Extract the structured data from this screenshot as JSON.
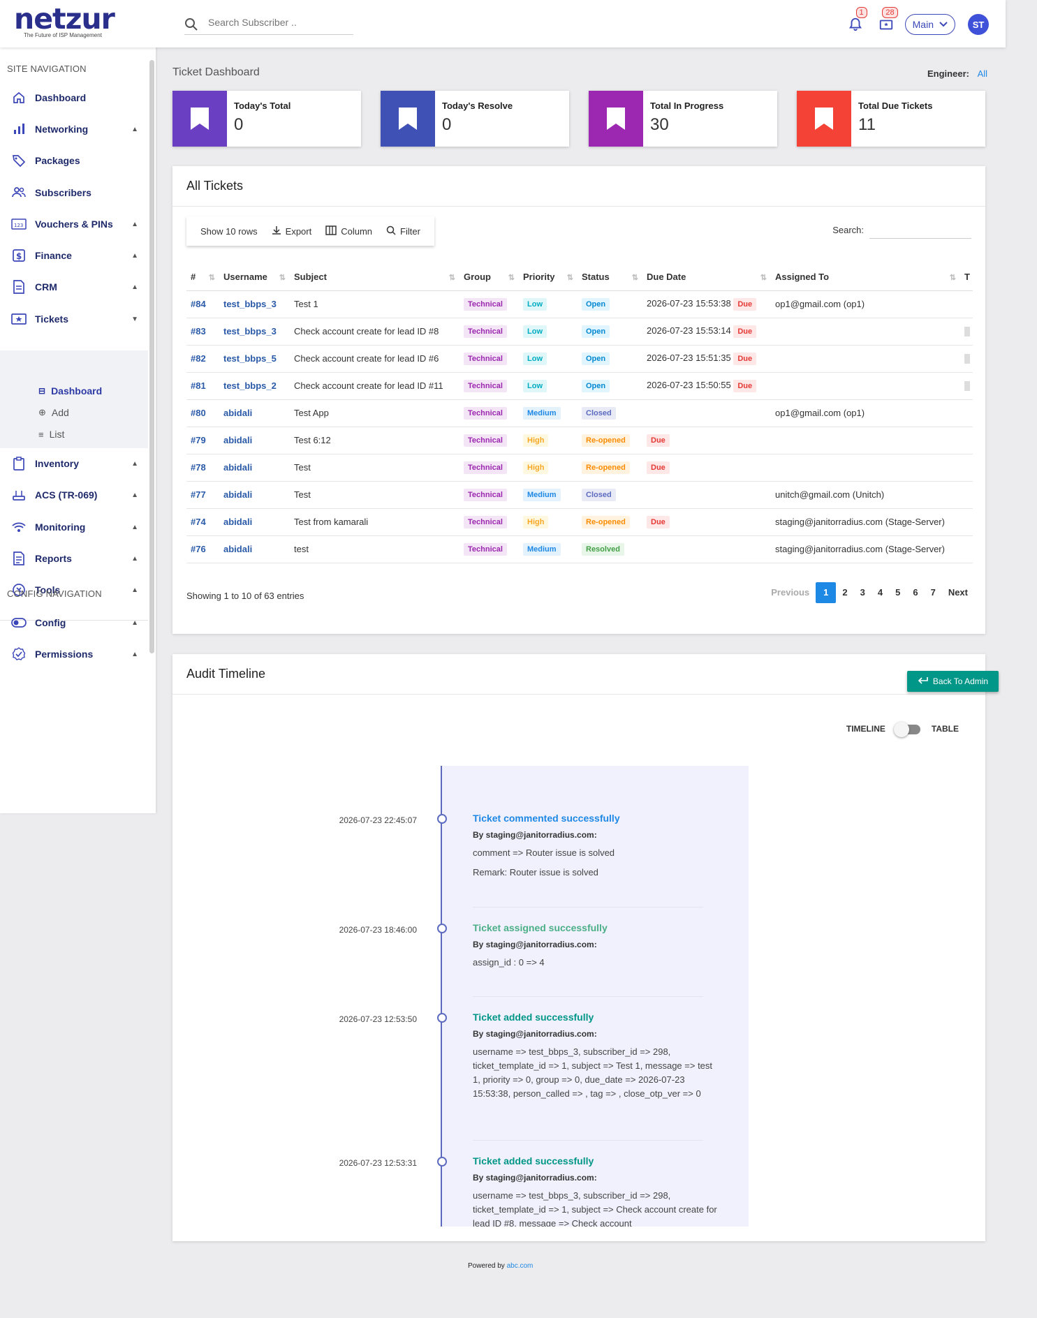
{
  "brand": {
    "name": "netzur",
    "tagline": "The Future of ISP Management"
  },
  "search": {
    "placeholder": "Search Subscriber .."
  },
  "header": {
    "notifications_count": "1",
    "tickets_count": "28",
    "branch": "Main",
    "avatar": "ST"
  },
  "sidebar": {
    "site_title": "SITE NAVIGATION",
    "items": [
      {
        "label": "Dashboard",
        "icon": "home-icon"
      },
      {
        "label": "Networking",
        "icon": "bar-chart-icon"
      },
      {
        "label": "Packages",
        "icon": "tag-icon"
      },
      {
        "label": "Subscribers",
        "icon": "users-icon"
      },
      {
        "label": "Vouchers & PINs",
        "icon": "voucher-icon"
      },
      {
        "label": "Finance",
        "icon": "dollar-icon"
      },
      {
        "label": "CRM",
        "icon": "document-icon"
      },
      {
        "label": "Tickets",
        "icon": "ticket-icon"
      },
      {
        "label": "Inventory",
        "icon": "clipboard-icon"
      },
      {
        "label": "ACS (TR-069)",
        "icon": "router-icon"
      },
      {
        "label": "Monitoring",
        "icon": "wifi-icon"
      },
      {
        "label": "Reports",
        "icon": "report-icon"
      },
      {
        "label": "Tools",
        "icon": "tools-icon"
      }
    ],
    "ticket_sub": [
      "Dashboard",
      "Add",
      "List"
    ],
    "config_title": "CONFIG NAVIGATION",
    "config_items": [
      {
        "label": "Config",
        "icon": "toggle-icon"
      },
      {
        "label": "Permissions",
        "icon": "badge-check-icon"
      }
    ]
  },
  "dashboard": {
    "title": "Ticket Dashboard",
    "engineer_label": "Engineer:",
    "engineer_value": "All",
    "stats": [
      {
        "label": "Today's Total",
        "value": "0",
        "color": "#6a3fc1"
      },
      {
        "label": "Today's Resolve",
        "value": "0",
        "color": "#3f51b5"
      },
      {
        "label": "Total In Progress",
        "value": "30",
        "color": "#9c27b0"
      },
      {
        "label": "Total Due Tickets",
        "value": "11",
        "color": "#f44336"
      }
    ]
  },
  "tickets": {
    "title": "All Tickets",
    "toolbar": {
      "show": "Show 10 rows",
      "export": "Export",
      "column": "Column",
      "filter": "Filter"
    },
    "search_label": "Search:",
    "columns": [
      "#",
      "Username",
      "Subject",
      "Group",
      "Priority",
      "Status",
      "Due Date",
      "Assigned To",
      "T"
    ],
    "rows": [
      {
        "id": "#84",
        "user": "test_bbps_3",
        "subject": "Test 1",
        "group": "Technical",
        "priority": "Low",
        "status": "Open",
        "due": "2026-07-23 15:53:38",
        "due_flag": "Due",
        "assigned": "op1@gmail.com (op1)"
      },
      {
        "id": "#83",
        "user": "test_bbps_3",
        "subject": "Check account create for lead ID #8",
        "group": "Technical",
        "priority": "Low",
        "status": "Open",
        "due": "2026-07-23 15:53:14",
        "due_flag": "Due",
        "assigned": ""
      },
      {
        "id": "#82",
        "user": "test_bbps_5",
        "subject": "Check account create for lead ID #6",
        "group": "Technical",
        "priority": "Low",
        "status": "Open",
        "due": "2026-07-23 15:51:35",
        "due_flag": "Due",
        "assigned": ""
      },
      {
        "id": "#81",
        "user": "test_bbps_2",
        "subject": "Check account create for lead ID #11",
        "group": "Technical",
        "priority": "Low",
        "status": "Open",
        "due": "2026-07-23 15:50:55",
        "due_flag": "Due",
        "assigned": ""
      },
      {
        "id": "#80",
        "user": "abidali",
        "subject": "Test App",
        "group": "Technical",
        "priority": "Medium",
        "status": "Closed",
        "due": "",
        "due_flag": "",
        "assigned": "op1@gmail.com (op1)"
      },
      {
        "id": "#79",
        "user": "abidali",
        "subject": "Test 6:12",
        "group": "Technical",
        "priority": "High",
        "status": "Re-opened",
        "due": "",
        "due_flag": "Due",
        "assigned": ""
      },
      {
        "id": "#78",
        "user": "abidali",
        "subject": "Test",
        "group": "Technical",
        "priority": "High",
        "status": "Re-opened",
        "due": "",
        "due_flag": "Due",
        "assigned": ""
      },
      {
        "id": "#77",
        "user": "abidali",
        "subject": "Test",
        "group": "Technical",
        "priority": "Medium",
        "status": "Closed",
        "due": "",
        "due_flag": "",
        "assigned": "unitch@gmail.com (Unitch)"
      },
      {
        "id": "#74",
        "user": "abidali",
        "subject": "Test from kamarali",
        "group": "Technical",
        "priority": "High",
        "status": "Re-opened",
        "due": "",
        "due_flag": "Due",
        "assigned": "staging@janitorradius.com (Stage-Server)"
      },
      {
        "id": "#76",
        "user": "abidali",
        "subject": "test",
        "group": "Technical",
        "priority": "Medium",
        "status": "Resolved",
        "due": "",
        "due_flag": "",
        "assigned": "staging@janitorradius.com (Stage-Server)"
      }
    ],
    "showing": "Showing 1 to 10 of 63 entries",
    "pager": {
      "prev": "Previous",
      "pages": [
        "1",
        "2",
        "3",
        "4",
        "5",
        "6",
        "7"
      ],
      "next": "Next",
      "current": "1"
    }
  },
  "audit": {
    "title": "Audit Timeline",
    "back_button": "Back To Admin",
    "toggle_left": "TIMELINE",
    "toggle_right": "TABLE",
    "entries": [
      {
        "time": "2026-07-23 22:45:07",
        "title": "Ticket commented successfully",
        "color": "#1e88e5",
        "by": "By staging@janitorradius.com:",
        "lines": [
          "comment => Router issue is solved",
          "Remark: Router issue is solved"
        ]
      },
      {
        "time": "2026-07-23 18:46:00",
        "title": "Ticket assigned successfully",
        "color": "#4caf87",
        "by": "By staging@janitorradius.com:",
        "lines": [
          "assign_id : 0 => 4"
        ]
      },
      {
        "time": "2026-07-23 12:53:50",
        "title": "Ticket added successfully",
        "color": "#009688",
        "by": "By staging@janitorradius.com:",
        "lines": [
          "username => test_bbps_3, subscriber_id => 298, ticket_template_id => 1, subject => Test 1, message => test 1, priority => 0, group => 0, due_date => 2026-07-23 15:53:38, person_called => , tag => , close_otp_ver => 0"
        ]
      },
      {
        "time": "2026-07-23 12:53:31",
        "title": "Ticket added successfully",
        "color": "#009688",
        "by": "By staging@janitorradius.com:",
        "lines": [
          "username => test_bbps_3, subscriber_id => 298, ticket_template_id => 1, subject => Check account create for lead ID #8, message => Check account"
        ]
      }
    ]
  },
  "footer": {
    "text": "Powered by",
    "link": "abc.com"
  }
}
